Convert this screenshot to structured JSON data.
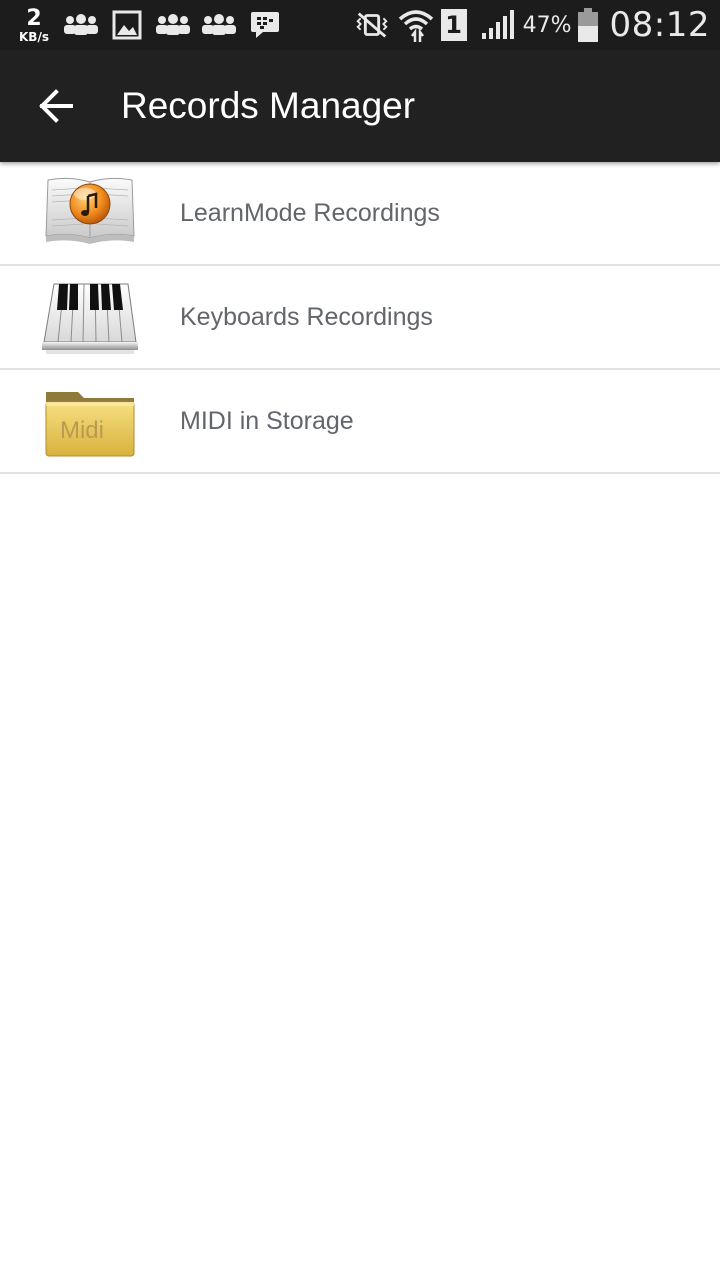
{
  "status_bar": {
    "speed_value": "2",
    "speed_unit": "KB/s",
    "notification_icons": [
      "group-icon",
      "gallery-icon",
      "group-icon",
      "group-icon",
      "bbm-icon"
    ],
    "system_icons": [
      "vibrate-icon",
      "wifi-icon"
    ],
    "sim_slot": "1",
    "battery_percent": "47%",
    "time": "08:12",
    "background_color": "#1c1c1c"
  },
  "app_bar": {
    "back_icon": "arrow-back-icon",
    "title": "Records Manager",
    "background_color": "#212121"
  },
  "list": {
    "items": [
      {
        "label": "LearnMode Recordings",
        "icon": "music-book-icon"
      },
      {
        "label": "Keyboards Recordings",
        "icon": "piano-keyboard-icon"
      },
      {
        "label": "MIDI in Storage",
        "icon": "midi-folder-icon",
        "icon_text": "Midi"
      }
    ],
    "label_color": "#62656b",
    "divider_color": "#e2e2e2"
  }
}
